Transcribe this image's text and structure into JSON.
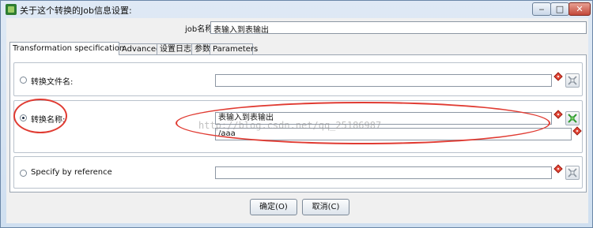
{
  "window": {
    "title": "关于这个转换的Job信息设置:",
    "icon": "kettle-job-icon",
    "controls": {
      "minimize": "‒",
      "maximize": "□",
      "close": "✕"
    }
  },
  "job_name": {
    "label": "job名称:",
    "value": "表输入到表输出"
  },
  "tabs": [
    {
      "label": "Transformation specification",
      "active": true
    },
    {
      "label": "Advanced",
      "active": false
    },
    {
      "label": "设置日志",
      "active": false
    },
    {
      "label": "参数",
      "active": false
    },
    {
      "label": "Parameters",
      "active": false
    }
  ],
  "options": {
    "file_name": {
      "label": "转换文件名:",
      "selected": false,
      "value": ""
    },
    "trans_name": {
      "label": "转换名称:",
      "selected": true,
      "name_value": "表输入到表输出",
      "directory_value": "/aaa"
    },
    "by_reference": {
      "label": "Specify by reference",
      "selected": false,
      "value": ""
    }
  },
  "watermark": "http://blog.csdn.net/qq_25186987",
  "buttons": {
    "ok": "确定(O)",
    "cancel": "取消(C)"
  },
  "colors": {
    "annotation": "#e03b32",
    "required_marker": "#e44a3a",
    "browse_active": "#2e9a2e"
  }
}
